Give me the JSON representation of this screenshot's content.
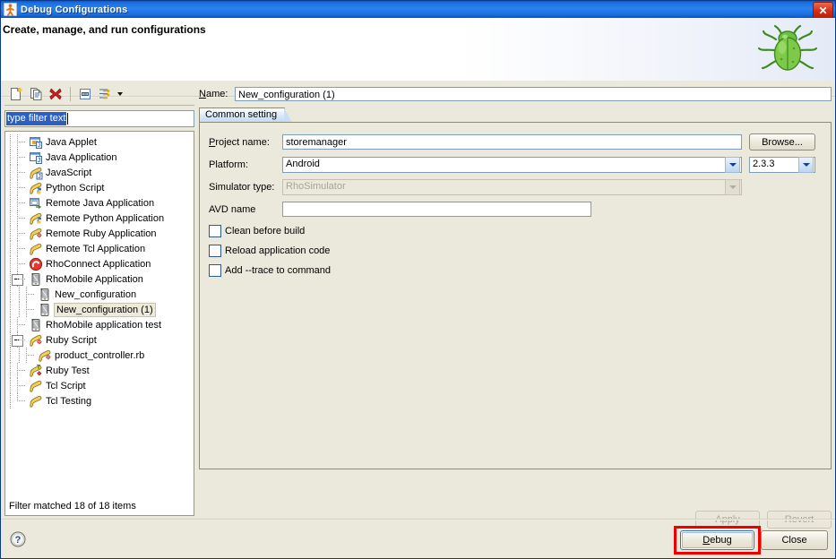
{
  "window": {
    "title": "Debug Configurations",
    "icon": "debug-launch-icon",
    "close_label": "✕"
  },
  "header": {
    "title": "Create, manage, and run configurations",
    "icon": "green-bug-icon"
  },
  "toolbar": {
    "buttons": [
      {
        "name": "new-launch-configuration",
        "icon": "new-file-icon"
      },
      {
        "name": "duplicate-launch-configuration",
        "icon": "copy-icon"
      },
      {
        "name": "delete-launch-configuration",
        "icon": "red-x-icon"
      },
      {
        "name": "collapse-all",
        "icon": "collapse-all-icon"
      },
      {
        "name": "filter-launch-configurations",
        "icon": "filter-icon"
      }
    ],
    "dropdown_arrow": "chevron-down-icon"
  },
  "filter": {
    "value": "type filter text",
    "placeholder": "type filter text",
    "selected": true,
    "status": "Filter matched 18 of 18 items"
  },
  "tree": {
    "items": [
      {
        "label": "Java Applet",
        "icon": "java-applet-icon",
        "depth": 1,
        "expander": null,
        "selected": false
      },
      {
        "label": "Java Application",
        "icon": "java-application-icon",
        "depth": 1,
        "expander": null,
        "selected": false
      },
      {
        "label": "JavaScript",
        "icon": "javascript-icon",
        "depth": 1,
        "expander": null,
        "selected": false
      },
      {
        "label": "Python Script",
        "icon": "python-script-icon",
        "depth": 1,
        "expander": null,
        "selected": false
      },
      {
        "label": "Remote Java Application",
        "icon": "remote-java-icon",
        "depth": 1,
        "expander": null,
        "selected": false
      },
      {
        "label": "Remote Python Application",
        "icon": "remote-python-icon",
        "depth": 1,
        "expander": null,
        "selected": false
      },
      {
        "label": "Remote Ruby Application",
        "icon": "remote-ruby-icon",
        "depth": 1,
        "expander": null,
        "selected": false
      },
      {
        "label": "Remote Tcl Application",
        "icon": "remote-tcl-icon",
        "depth": 1,
        "expander": null,
        "selected": false
      },
      {
        "label": "RhoConnect Application",
        "icon": "rhoconnect-icon",
        "depth": 1,
        "expander": null,
        "selected": false
      },
      {
        "label": "RhoMobile Application",
        "icon": "rhomobile-icon",
        "depth": 1,
        "expander": "collapse",
        "selected": false
      },
      {
        "label": "New_configuration",
        "icon": "rhomobile-icon",
        "depth": 2,
        "expander": null,
        "selected": false
      },
      {
        "label": "New_configuration (1)",
        "icon": "rhomobile-icon",
        "depth": 2,
        "expander": null,
        "selected": true
      },
      {
        "label": "RhoMobile application test",
        "icon": "rhomobile-icon",
        "depth": 1,
        "expander": null,
        "selected": false
      },
      {
        "label": "Ruby Script",
        "icon": "ruby-script-icon",
        "depth": 1,
        "expander": "collapse",
        "selected": false
      },
      {
        "label": "product_controller.rb",
        "icon": "ruby-script-icon",
        "depth": 2,
        "expander": null,
        "selected": false
      },
      {
        "label": "Ruby Test",
        "icon": "ruby-test-icon",
        "depth": 1,
        "expander": null,
        "selected": false
      },
      {
        "label": "Tcl Script",
        "icon": "tcl-script-icon",
        "depth": 1,
        "expander": null,
        "selected": false
      },
      {
        "label": "Tcl Testing",
        "icon": "tcl-testing-icon",
        "depth": 1,
        "expander": null,
        "selected": false
      }
    ]
  },
  "config": {
    "name_label": "Name:",
    "name_value": "New_configuration (1)",
    "tab_label": "Common setting",
    "project_label": "Project name:",
    "project_value": "storemanager",
    "browse_label": "Browse...",
    "platform_label": "Platform:",
    "platform_value": "Android",
    "version_value": "2.3.3",
    "simulator_label": "Simulator type:",
    "simulator_value": "RhoSimulator",
    "simulator_disabled": true,
    "avd_label": "AVD name",
    "avd_value": "",
    "checkboxes": [
      {
        "label": "Clean before build",
        "checked": false,
        "name": "clean-before-build"
      },
      {
        "label": "Reload application code",
        "checked": false,
        "name": "reload-application-code"
      },
      {
        "label": "Add --trace to command",
        "checked": false,
        "name": "add-trace-to-command"
      }
    ]
  },
  "actions": {
    "apply_label": "Apply",
    "apply_disabled": true,
    "revert_label": "Revert",
    "revert_disabled": true,
    "debug_label": "Debug",
    "debug_focused": true,
    "close_label": "Close",
    "help_icon": "question-mark-icon"
  },
  "colors": {
    "titlebar_blue": "#2b82ef",
    "dialog_bg": "#ebe8dc",
    "selection_blue": "#2c5fbe",
    "tree_selected_bg": "#eeeadb",
    "annotation_red": "#ee0000",
    "accent_bug_green": "#6fbf3f"
  }
}
